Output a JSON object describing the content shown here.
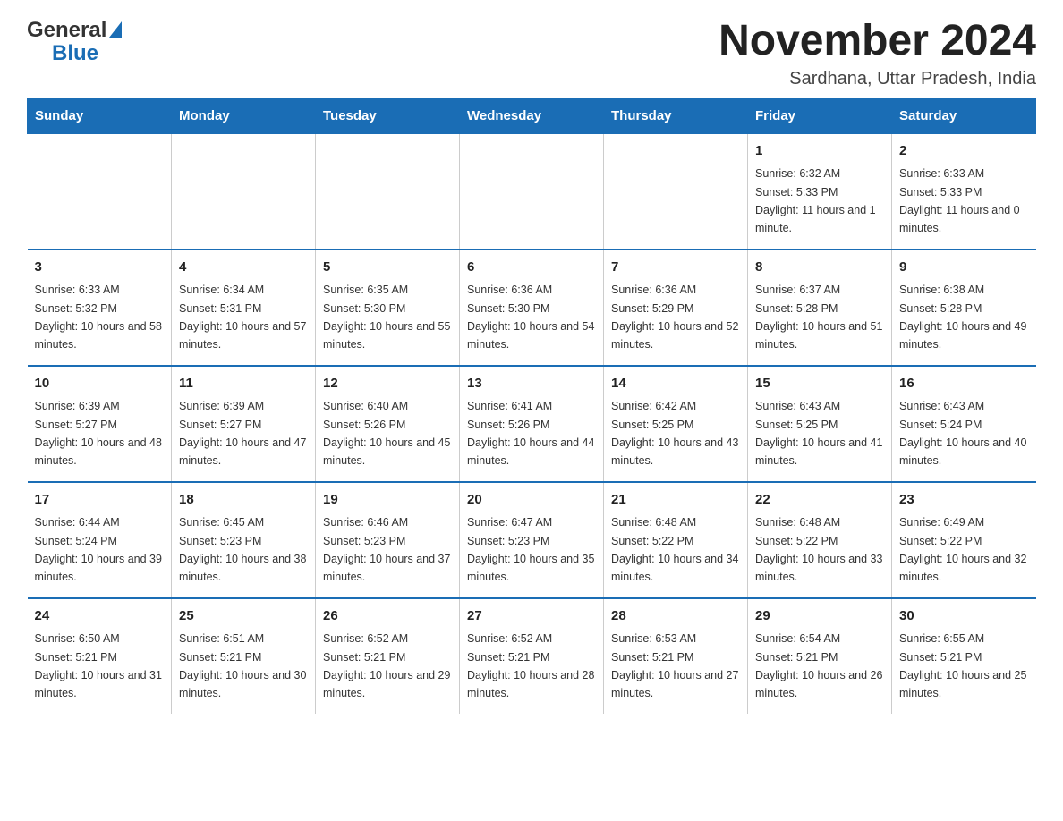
{
  "header": {
    "logo": {
      "general": "General",
      "blue": "Blue"
    },
    "title": "November 2024",
    "subtitle": "Sardhana, Uttar Pradesh, India"
  },
  "calendar": {
    "days_of_week": [
      "Sunday",
      "Monday",
      "Tuesday",
      "Wednesday",
      "Thursday",
      "Friday",
      "Saturday"
    ],
    "weeks": [
      [
        {
          "day": "",
          "info": ""
        },
        {
          "day": "",
          "info": ""
        },
        {
          "day": "",
          "info": ""
        },
        {
          "day": "",
          "info": ""
        },
        {
          "day": "",
          "info": ""
        },
        {
          "day": "1",
          "info": "Sunrise: 6:32 AM\nSunset: 5:33 PM\nDaylight: 11 hours and 1 minute."
        },
        {
          "day": "2",
          "info": "Sunrise: 6:33 AM\nSunset: 5:33 PM\nDaylight: 11 hours and 0 minutes."
        }
      ],
      [
        {
          "day": "3",
          "info": "Sunrise: 6:33 AM\nSunset: 5:32 PM\nDaylight: 10 hours and 58 minutes."
        },
        {
          "day": "4",
          "info": "Sunrise: 6:34 AM\nSunset: 5:31 PM\nDaylight: 10 hours and 57 minutes."
        },
        {
          "day": "5",
          "info": "Sunrise: 6:35 AM\nSunset: 5:30 PM\nDaylight: 10 hours and 55 minutes."
        },
        {
          "day": "6",
          "info": "Sunrise: 6:36 AM\nSunset: 5:30 PM\nDaylight: 10 hours and 54 minutes."
        },
        {
          "day": "7",
          "info": "Sunrise: 6:36 AM\nSunset: 5:29 PM\nDaylight: 10 hours and 52 minutes."
        },
        {
          "day": "8",
          "info": "Sunrise: 6:37 AM\nSunset: 5:28 PM\nDaylight: 10 hours and 51 minutes."
        },
        {
          "day": "9",
          "info": "Sunrise: 6:38 AM\nSunset: 5:28 PM\nDaylight: 10 hours and 49 minutes."
        }
      ],
      [
        {
          "day": "10",
          "info": "Sunrise: 6:39 AM\nSunset: 5:27 PM\nDaylight: 10 hours and 48 minutes."
        },
        {
          "day": "11",
          "info": "Sunrise: 6:39 AM\nSunset: 5:27 PM\nDaylight: 10 hours and 47 minutes."
        },
        {
          "day": "12",
          "info": "Sunrise: 6:40 AM\nSunset: 5:26 PM\nDaylight: 10 hours and 45 minutes."
        },
        {
          "day": "13",
          "info": "Sunrise: 6:41 AM\nSunset: 5:26 PM\nDaylight: 10 hours and 44 minutes."
        },
        {
          "day": "14",
          "info": "Sunrise: 6:42 AM\nSunset: 5:25 PM\nDaylight: 10 hours and 43 minutes."
        },
        {
          "day": "15",
          "info": "Sunrise: 6:43 AM\nSunset: 5:25 PM\nDaylight: 10 hours and 41 minutes."
        },
        {
          "day": "16",
          "info": "Sunrise: 6:43 AM\nSunset: 5:24 PM\nDaylight: 10 hours and 40 minutes."
        }
      ],
      [
        {
          "day": "17",
          "info": "Sunrise: 6:44 AM\nSunset: 5:24 PM\nDaylight: 10 hours and 39 minutes."
        },
        {
          "day": "18",
          "info": "Sunrise: 6:45 AM\nSunset: 5:23 PM\nDaylight: 10 hours and 38 minutes."
        },
        {
          "day": "19",
          "info": "Sunrise: 6:46 AM\nSunset: 5:23 PM\nDaylight: 10 hours and 37 minutes."
        },
        {
          "day": "20",
          "info": "Sunrise: 6:47 AM\nSunset: 5:23 PM\nDaylight: 10 hours and 35 minutes."
        },
        {
          "day": "21",
          "info": "Sunrise: 6:48 AM\nSunset: 5:22 PM\nDaylight: 10 hours and 34 minutes."
        },
        {
          "day": "22",
          "info": "Sunrise: 6:48 AM\nSunset: 5:22 PM\nDaylight: 10 hours and 33 minutes."
        },
        {
          "day": "23",
          "info": "Sunrise: 6:49 AM\nSunset: 5:22 PM\nDaylight: 10 hours and 32 minutes."
        }
      ],
      [
        {
          "day": "24",
          "info": "Sunrise: 6:50 AM\nSunset: 5:21 PM\nDaylight: 10 hours and 31 minutes."
        },
        {
          "day": "25",
          "info": "Sunrise: 6:51 AM\nSunset: 5:21 PM\nDaylight: 10 hours and 30 minutes."
        },
        {
          "day": "26",
          "info": "Sunrise: 6:52 AM\nSunset: 5:21 PM\nDaylight: 10 hours and 29 minutes."
        },
        {
          "day": "27",
          "info": "Sunrise: 6:52 AM\nSunset: 5:21 PM\nDaylight: 10 hours and 28 minutes."
        },
        {
          "day": "28",
          "info": "Sunrise: 6:53 AM\nSunset: 5:21 PM\nDaylight: 10 hours and 27 minutes."
        },
        {
          "day": "29",
          "info": "Sunrise: 6:54 AM\nSunset: 5:21 PM\nDaylight: 10 hours and 26 minutes."
        },
        {
          "day": "30",
          "info": "Sunrise: 6:55 AM\nSunset: 5:21 PM\nDaylight: 10 hours and 25 minutes."
        }
      ]
    ]
  }
}
